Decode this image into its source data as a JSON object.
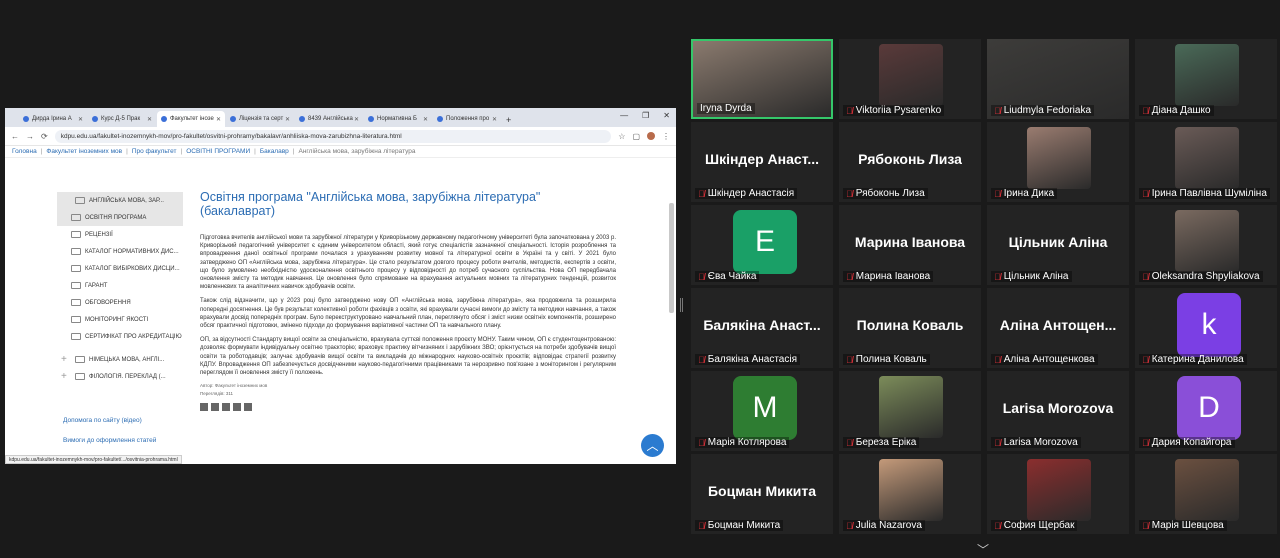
{
  "browser": {
    "tabs": [
      {
        "label": "Дирда Ірина А",
        "active": false
      },
      {
        "label": "Курс Д-5 Прак",
        "active": false
      },
      {
        "label": "Факультет інозе",
        "active": true
      },
      {
        "label": "Ліцензія та серт",
        "active": false
      },
      {
        "label": "8439 Англійська",
        "active": false
      },
      {
        "label": "Нормативна Б",
        "active": false
      },
      {
        "label": "Положення про",
        "active": false
      }
    ],
    "url": "kdpu.edu.ua/fakultet-inozemnykh-mov/pro-fakultet/osvitni-prohramy/bakalavr/anhliiska-mova-zarubizhna-literatura.html",
    "status_url": "kdpu.edu.ua/fakultet-inozemnykh-mov/pro-fakultet/.../osvitnia-prohrama.html"
  },
  "breadcrumbs": [
    "Головна",
    "Факультет іноземних мов",
    "Про факультет",
    "ОСВІТНІ ПРОГРАМИ",
    "Бакалавр",
    "Англійська мова, зарубіжна література"
  ],
  "sidebar": {
    "items": [
      {
        "label": "АНГЛІЙСЬКА МОВА, ЗАР...",
        "type": "parent",
        "selected": true
      },
      {
        "label": "ОСВІТНЯ ПРОГРАМА",
        "type": "child",
        "selected": true
      },
      {
        "label": "РЕЦЕНЗІЇ",
        "type": "child"
      },
      {
        "label": "КАТАЛОГ НОРМАТИВНИХ ДИС...",
        "type": "child"
      },
      {
        "label": "КАТАЛОГ ВИБІРКОВИХ ДИСЦИ...",
        "type": "child"
      },
      {
        "label": "ГАРАНТ",
        "type": "child"
      },
      {
        "label": "ОБГОВОРЕННЯ",
        "type": "child"
      },
      {
        "label": "МОНІТОРИНГ ЯКОСТІ",
        "type": "child"
      },
      {
        "label": "СЕРТИФІКАТ ПРО АКРЕДИТАЦІЮ",
        "type": "child"
      },
      {
        "label": "НІМЕЦЬКА МОВА, АНГЛІ...",
        "type": "parent-plus"
      },
      {
        "label": "ФІЛОЛОГІЯ. ПЕРЕКЛАД (...",
        "type": "parent-plus"
      }
    ],
    "links": [
      "Допомога по сайту (відео)",
      "Вимоги до оформлення статей"
    ]
  },
  "article": {
    "title": "Освітня програма \"Англійська мова, зарубіжна література\" (бакалаврат)",
    "paragraphs": [
      "Підготовка вчителів англійської мови та зарубіжної літератури у Криворізькому державному педагогічному університеті була започаткована у 2003 р. Криворізький педагогічний університет є єдиним університетом області, який готує спеціалістів зазначеної спеціальності. Історія розроблення та впровадження даної освітньої програми почалася з урахуванням розвитку мовної та літературної освіти в Україні та у світі. У 2021 було затверджено ОП «Англійська мова, зарубіжна література». Це стало результатом довгого процесу роботи вчителів, методистів, експертів з освіти, що було зумовлено необхідністю удосконалення освітнього процесу у відповідності до потреб сучасного суспільства. Нова ОП передбачала оновлення змісту та методик навчання. Це оновлення було спрямоване на врахування актуальних мовних та літературних тенденцій, розвиток мовленнєвих та аналітичних навичок здобувачів освіти.",
      "Також слід відзначити, що у 2023 році було затверджено нову ОП «Англійська мова, зарубіжна література», яка продовжила та розширила попередні досягнення. Це був результат колективної роботи фахівців з освіти, які врахували сучасні вимоги до змісту та методики навчання, а також врахували досвід попередніх програм. Було перекструктуровано навчальний план, переглянуто обсяг і зміст низки освітніх компонентів, розширено обсяг практичної підготовки, змінено підходи до формування варіативної частини ОП та навчального плану.",
      "ОП, за відсутності Стандарту вищої освіти за спеціальністю, врахувала суттєві положення проєкту МОНУ. Таким чином, ОП є студентоцентрованою: дозволяє формувати індивідуальну освітню траєкторію; враховує практику вітчизняних і зарубіжних ЗВО; орієнтується на потреби здобувачів вищої освіти та роботодавців; залучає здобувачів вищої освіти та викладачів до міжнародних науково-освітніх проєктів; відповідає стратегії розвитку КДПУ. Впровадження ОП забезпечується досвідченими науково-педагогічними працівниками та нерозривно пов'язане з моніторингом і регулярним переглядом її оновлення змісту її положень."
    ],
    "author": "Автор: Факультет іноземних мов",
    "views": "Переглядів: 311"
  },
  "participants": [
    {
      "name": "Iryna Dyrda",
      "display": "photo",
      "muted": false,
      "speaking": true,
      "color": "#8a7a6e"
    },
    {
      "name": "Viktoriia Pysarenko",
      "display": "photo",
      "muted": true,
      "color": "#5a3a3a"
    },
    {
      "name": "Liudmyla Fedoriaka",
      "display": "photo",
      "muted": true,
      "color": "#3d3c3a"
    },
    {
      "name": "Діана Дашко",
      "display": "photo",
      "muted": true,
      "color": "#4a6a58"
    },
    {
      "name": "Шкіндер Анастасія",
      "display": "text",
      "big": "Шкіндер Анаст...",
      "muted": true
    },
    {
      "name": "Рябоконь Лиза",
      "display": "text",
      "big": "Рябоконь Лиза",
      "muted": true
    },
    {
      "name": "Ірина Дика",
      "display": "photo",
      "muted": true,
      "color": "#9a7c70"
    },
    {
      "name": "Ірина Павлівна Шуміліна",
      "display": "photo",
      "muted": true,
      "color": "#6a5b57"
    },
    {
      "name": "Єва Чайка",
      "display": "letter",
      "letter": "E",
      "muted": true,
      "color": "#1aa067"
    },
    {
      "name": "Марина Іванова",
      "display": "text",
      "big": "Марина Іванова",
      "muted": true
    },
    {
      "name": "Цільник Аліна",
      "display": "text",
      "big": "Цільник Аліна",
      "muted": true
    },
    {
      "name": "Oleksandra Shpyliakova",
      "display": "photo",
      "muted": true,
      "color": "#7a6a60"
    },
    {
      "name": "Балякіна Анастасія",
      "display": "text",
      "big": "Балякіна Анаст...",
      "muted": true
    },
    {
      "name": "Полина Коваль",
      "display": "text",
      "big": "Полина Коваль",
      "muted": true
    },
    {
      "name": "Аліна Антощенкова",
      "display": "text",
      "big": "Аліна Антощен...",
      "muted": true
    },
    {
      "name": "Катерина Данилова",
      "display": "letter",
      "letter": "k",
      "muted": true,
      "color": "#7b3fe4"
    },
    {
      "name": "Марія Котлярова",
      "display": "letter",
      "letter": "M",
      "muted": true,
      "color": "#2e7d32"
    },
    {
      "name": "Береза Еріка",
      "display": "photo",
      "muted": true,
      "color": "#7c8c5a"
    },
    {
      "name": "Larisa Morozova",
      "display": "text",
      "big": "Larisa Morozova",
      "muted": true
    },
    {
      "name": "Дария Копайгора",
      "display": "letter",
      "letter": "D",
      "muted": true,
      "color": "#8a4fd8"
    },
    {
      "name": "Боцман Микита",
      "display": "text",
      "big": "Боцман Микита",
      "muted": true
    },
    {
      "name": "Julia Nazarova",
      "display": "photo",
      "muted": true,
      "color": "#c49a7a"
    },
    {
      "name": "София Щербак",
      "display": "photo",
      "muted": true,
      "color": "#8b2e2e"
    },
    {
      "name": "Марія Шевцова",
      "display": "photo",
      "muted": true,
      "color": "#6b5040"
    }
  ]
}
